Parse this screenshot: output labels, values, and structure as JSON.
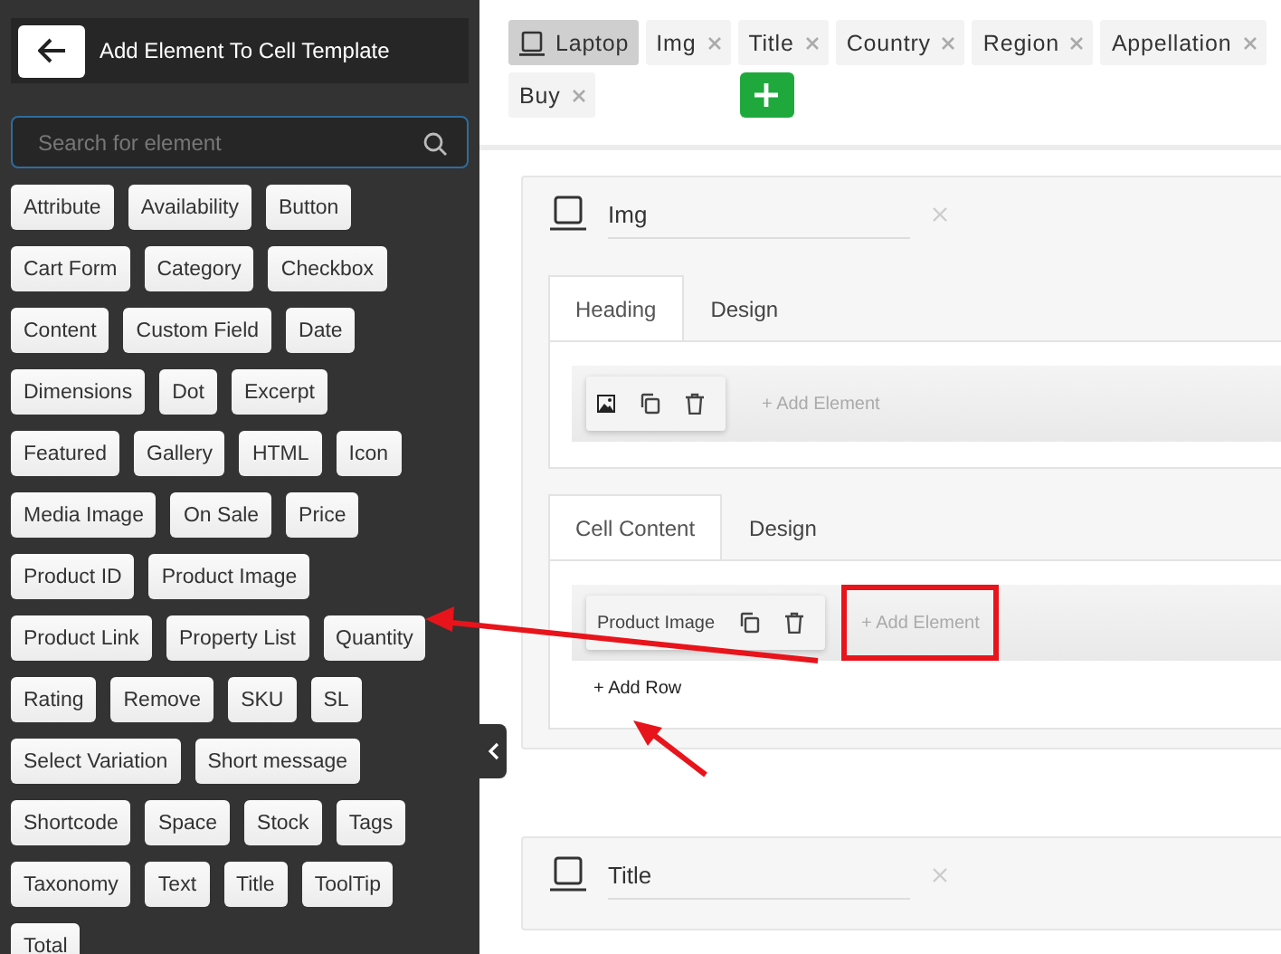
{
  "sidebar": {
    "title": "Add Element To Cell Template",
    "search": {
      "placeholder": "Search for element"
    },
    "elements": [
      "Attribute",
      "Availability",
      "Button",
      "Cart Form",
      "Category",
      "Checkbox",
      "Content",
      "Custom Field",
      "Date",
      "Dimensions",
      "Dot",
      "Excerpt",
      "Featured",
      "Gallery",
      "HTML",
      "Icon",
      "Media Image",
      "On Sale",
      "Price",
      "Product ID",
      "Product Image",
      "Product Link",
      "Property List",
      "Quantity",
      "Rating",
      "Remove",
      "SKU",
      "SL",
      "Select Variation",
      "Short message",
      "Shortcode",
      "Space",
      "Stock",
      "Tags",
      "Taxonomy",
      "Text",
      "Title",
      "ToolTip",
      "Total"
    ]
  },
  "column_tabs": [
    {
      "kind": "device",
      "label": "Laptop",
      "selected": true
    },
    {
      "kind": "column",
      "label": "Img",
      "selected": false
    },
    {
      "kind": "column",
      "label": "Title",
      "selected": false
    },
    {
      "kind": "column",
      "label": "Country",
      "selected": false
    },
    {
      "kind": "column",
      "label": "Region",
      "selected": false
    },
    {
      "kind": "column",
      "label": "Appellation",
      "selected": false
    },
    {
      "kind": "column",
      "label": "Buy",
      "selected": false
    }
  ],
  "columns": [
    {
      "name": "Img",
      "sections": [
        {
          "tabs": [
            {
              "label": "Heading",
              "selected": true
            },
            {
              "label": "Design",
              "selected": false
            }
          ],
          "element": {
            "kind": "icon"
          },
          "add_element": "+ Add Element",
          "highlighted": false
        },
        {
          "tabs": [
            {
              "label": "Cell Content",
              "selected": true
            },
            {
              "label": "Design",
              "selected": false
            }
          ],
          "element": {
            "kind": "text",
            "label": "Product Image"
          },
          "add_element": "+ Add Element",
          "highlighted": true,
          "add_row": "+ Add Row"
        }
      ]
    },
    {
      "name": "Title"
    }
  ]
}
